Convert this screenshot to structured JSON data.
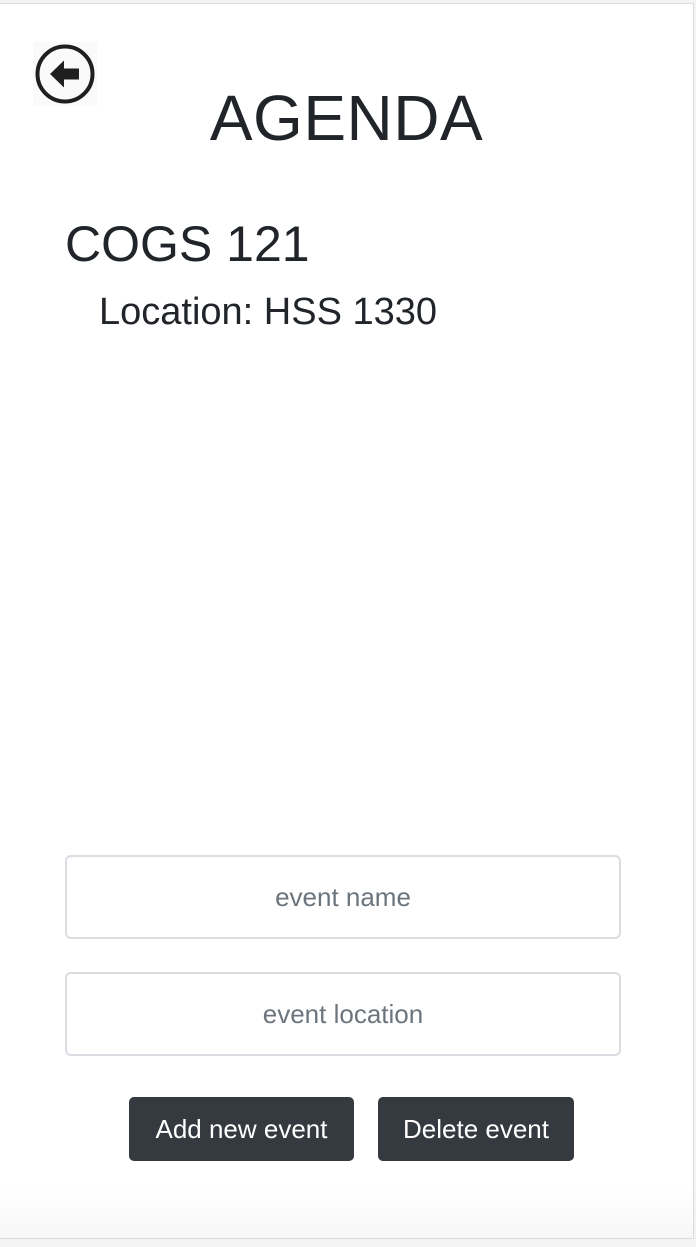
{
  "header": {
    "back_icon": "circle-arrow-left-icon",
    "title": "AGENDA"
  },
  "course": {
    "name": "COGS 121",
    "location": "Location: HSS 1330"
  },
  "form": {
    "event_name_placeholder": "event name",
    "event_name_value": "",
    "event_location_placeholder": "event location",
    "event_location_value": "",
    "add_label": "Add new event",
    "delete_label": "Delete event"
  },
  "colors": {
    "text": "#212529",
    "button_bg": "#343a40",
    "button_text": "#ffffff",
    "input_border": "#dadde1",
    "placeholder": "#6c757d"
  }
}
